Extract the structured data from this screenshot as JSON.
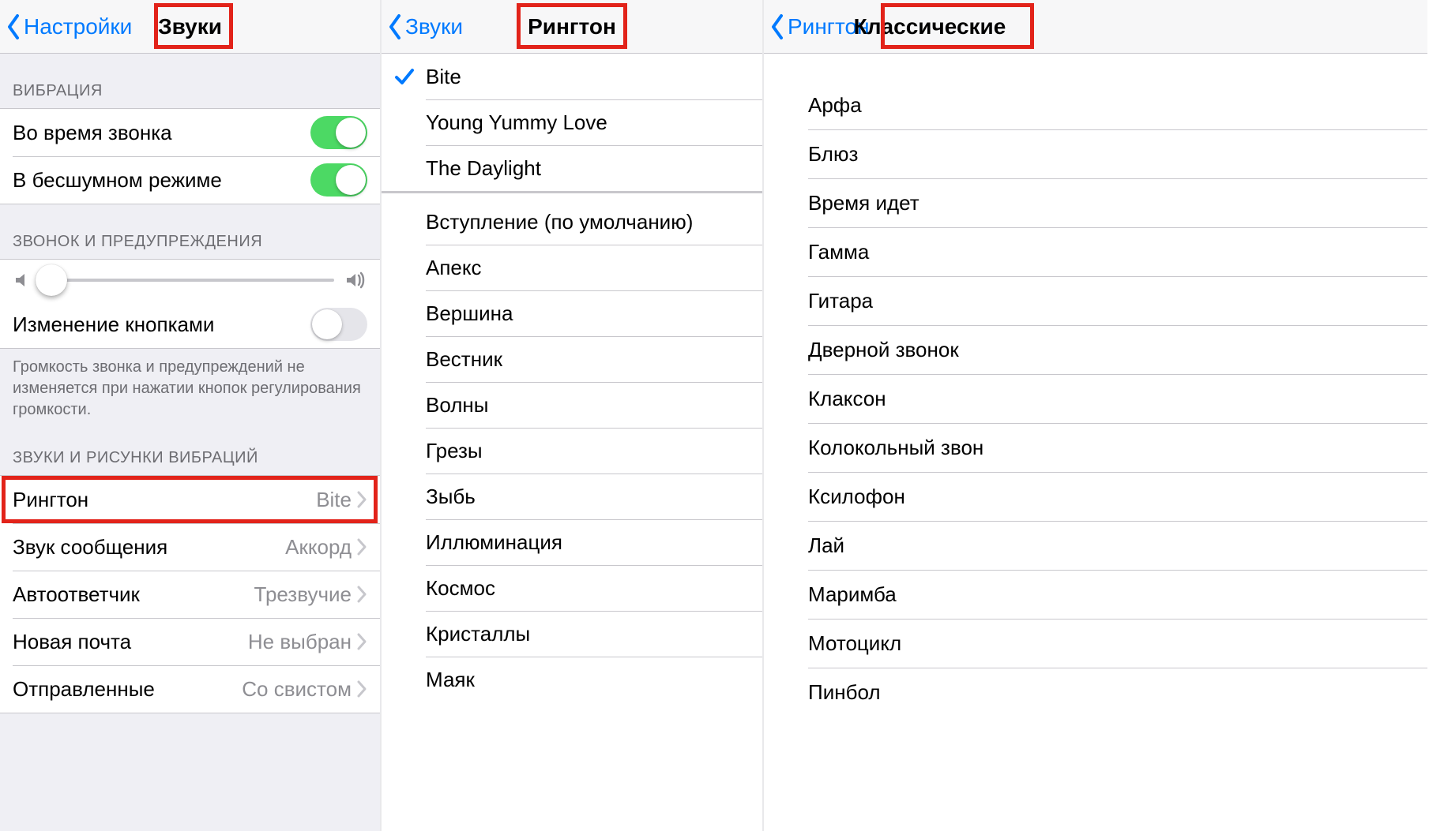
{
  "pane1": {
    "nav": {
      "back": "Настройки",
      "title": "Звуки"
    },
    "section_vibration": "ВИБРАЦИЯ",
    "vibrate_on_ring": "Во время звонка",
    "vibrate_on_silent": "В бесшумном режиме",
    "section_ringer": "ЗВОНОК И ПРЕДУПРЕЖДЕНИЯ",
    "change_with_buttons": "Изменение кнопками",
    "footer_ringer": "Громкость звонка и предупреждений не изменяется при нажатии кнопок регулирования громкости.",
    "section_sounds": "ЗВУКИ И РИСУНКИ ВИБРАЦИЙ",
    "rows": {
      "ringtone": {
        "label": "Рингтон",
        "value": "Bite"
      },
      "text_tone": {
        "label": "Звук сообщения",
        "value": "Аккорд"
      },
      "voicemail": {
        "label": "Автоответчик",
        "value": "Трезвучие"
      },
      "new_mail": {
        "label": "Новая почта",
        "value": "Не выбран"
      },
      "sent_mail": {
        "label": "Отправленные",
        "value": "Со свистом"
      }
    }
  },
  "pane2": {
    "nav": {
      "back": "Звуки",
      "title": "Рингтон"
    },
    "custom": [
      "Bite",
      "Young Yummy Love",
      "The Daylight"
    ],
    "selected_index": 0,
    "builtin": [
      "Вступление (по умолчанию)",
      "Апекс",
      "Вершина",
      "Вестник",
      "Волны",
      "Грезы",
      "Зыбь",
      "Иллюминация",
      "Космос",
      "Кристаллы",
      "Маяк"
    ]
  },
  "pane3": {
    "nav": {
      "back": "Рингтон",
      "title": "Классические"
    },
    "items": [
      "Арфа",
      "Блюз",
      "Время идет",
      "Гамма",
      "Гитара",
      "Дверной звонок",
      "Клаксон",
      "Колокольный звон",
      "Ксилофон",
      "Лай",
      "Маримба",
      "Мотоцикл",
      "Пинбол"
    ]
  }
}
